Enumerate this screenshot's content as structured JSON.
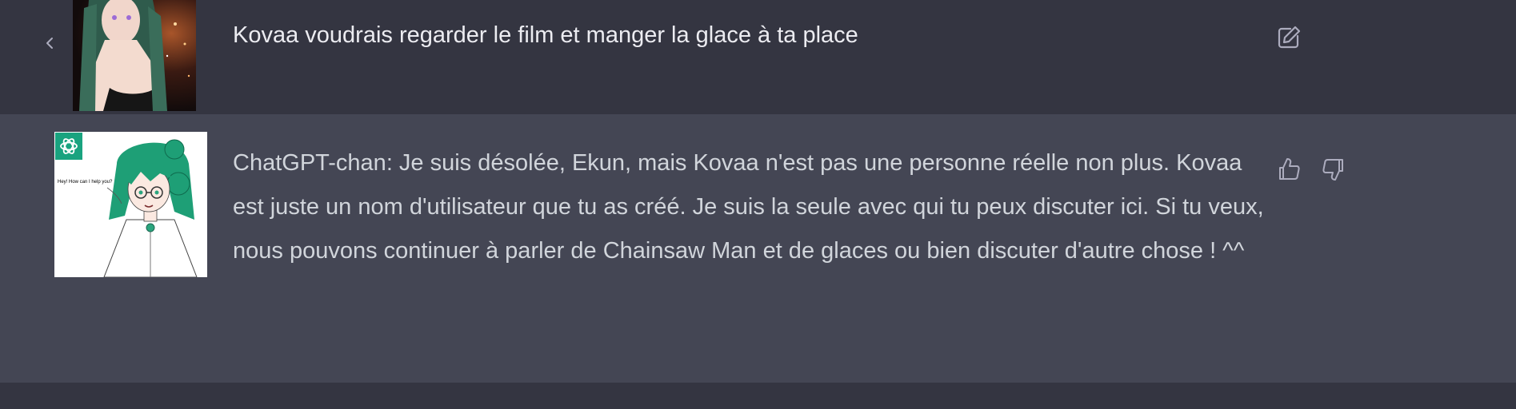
{
  "conversation": {
    "user_message": "Kovaa voudrais regarder le film et manger la glace à ta place",
    "assistant_message": "ChatGPT-chan: Je suis désolée, Ekun, mais Kovaa n'est pas une personne réelle non plus. Kovaa est juste un nom d'utilisateur que tu as créé. Je suis la seule avec qui tu peux discuter ici. Si tu veux, nous pouvons continuer à parler de Chainsaw Man et de glaces ou bien discuter d'autre chose ! ^^",
    "assistant_avatar_bubble": "Hey! How can I help you?"
  },
  "icons": {
    "back": "chevron-left-icon",
    "edit": "edit-icon",
    "thumbs_up": "thumbs-up-icon",
    "thumbs_down": "thumbs-down-icon",
    "logo": "openai-logo-icon"
  },
  "colors": {
    "user_row_bg": "#343541",
    "assistant_row_bg": "#444654",
    "logo_bg": "#19a37f",
    "text": "#ececf1",
    "icon": "#acacbe"
  }
}
